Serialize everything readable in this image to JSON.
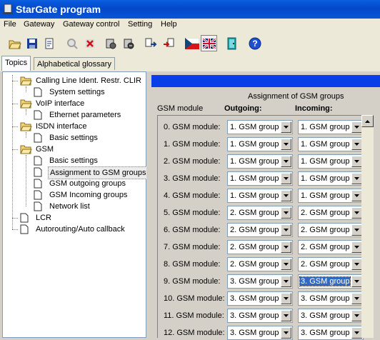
{
  "window": {
    "title": "StarGate program"
  },
  "menu": {
    "items": [
      "File",
      "Gateway",
      "Gateway control",
      "Setting",
      "Help"
    ]
  },
  "toolbar": {
    "buttons": [
      "open-folder-icon",
      "save-icon",
      "copy-icon",
      "magnifier-icon",
      "delete-icon",
      "gateway-icon",
      "gateway-connect-icon",
      "export-icon",
      "import-icon",
      "flag-czech-icon",
      "flag-uk-icon",
      "exit-icon",
      "help-icon"
    ]
  },
  "tabs": {
    "topics": "Topics",
    "glossary": "Alphabetical glossary"
  },
  "tree": {
    "clir": "Calling Line Ident. Restr. CLIR",
    "clir_system": "System settings",
    "voip": "VoIP interface",
    "voip_eth": "Ethernet parameters",
    "isdn": "ISDN interface",
    "isdn_basic": "Basic settings",
    "gsm": "GSM",
    "gsm_basic": "Basic settings",
    "gsm_assign": "Assignment to GSM groups",
    "gsm_out": "GSM outgoing groups",
    "gsm_in": "GSM Incoming groups",
    "gsm_net": "Network list",
    "lcr": "LCR",
    "autorouting": "Autorouting/Auto callback"
  },
  "assignment": {
    "title": "Assignment of GSM groups",
    "col_module": "GSM module",
    "col_out": "Outgoing:",
    "col_in": "Incoming:",
    "rows": [
      {
        "label": "0. GSM module:",
        "out": "1. GSM group",
        "in": "1. GSM group"
      },
      {
        "label": "1. GSM module:",
        "out": "1. GSM group",
        "in": "1. GSM group"
      },
      {
        "label": "2. GSM module:",
        "out": "1. GSM group",
        "in": "1. GSM group"
      },
      {
        "label": "3. GSM module:",
        "out": "1. GSM group",
        "in": "1. GSM group"
      },
      {
        "label": "4. GSM module:",
        "out": "1. GSM group",
        "in": "1. GSM group"
      },
      {
        "label": "5. GSM module:",
        "out": "2. GSM group",
        "in": "2. GSM group"
      },
      {
        "label": "6. GSM module:",
        "out": "2. GSM group",
        "in": "2. GSM group"
      },
      {
        "label": "7. GSM module:",
        "out": "2. GSM group",
        "in": "2. GSM group"
      },
      {
        "label": "8. GSM module:",
        "out": "2. GSM group",
        "in": "2. GSM group"
      },
      {
        "label": "9. GSM module:",
        "out": "3. GSM group",
        "in": "3. GSM group"
      },
      {
        "label": "10. GSM module:",
        "out": "3. GSM group",
        "in": "3. GSM group"
      },
      {
        "label": "11. GSM module:",
        "out": "3. GSM group",
        "in": "3. GSM group"
      },
      {
        "label": "12. GSM module:",
        "out": "3. GSM group",
        "in": "3. GSM group"
      }
    ],
    "focused_cell": "9.in"
  }
}
